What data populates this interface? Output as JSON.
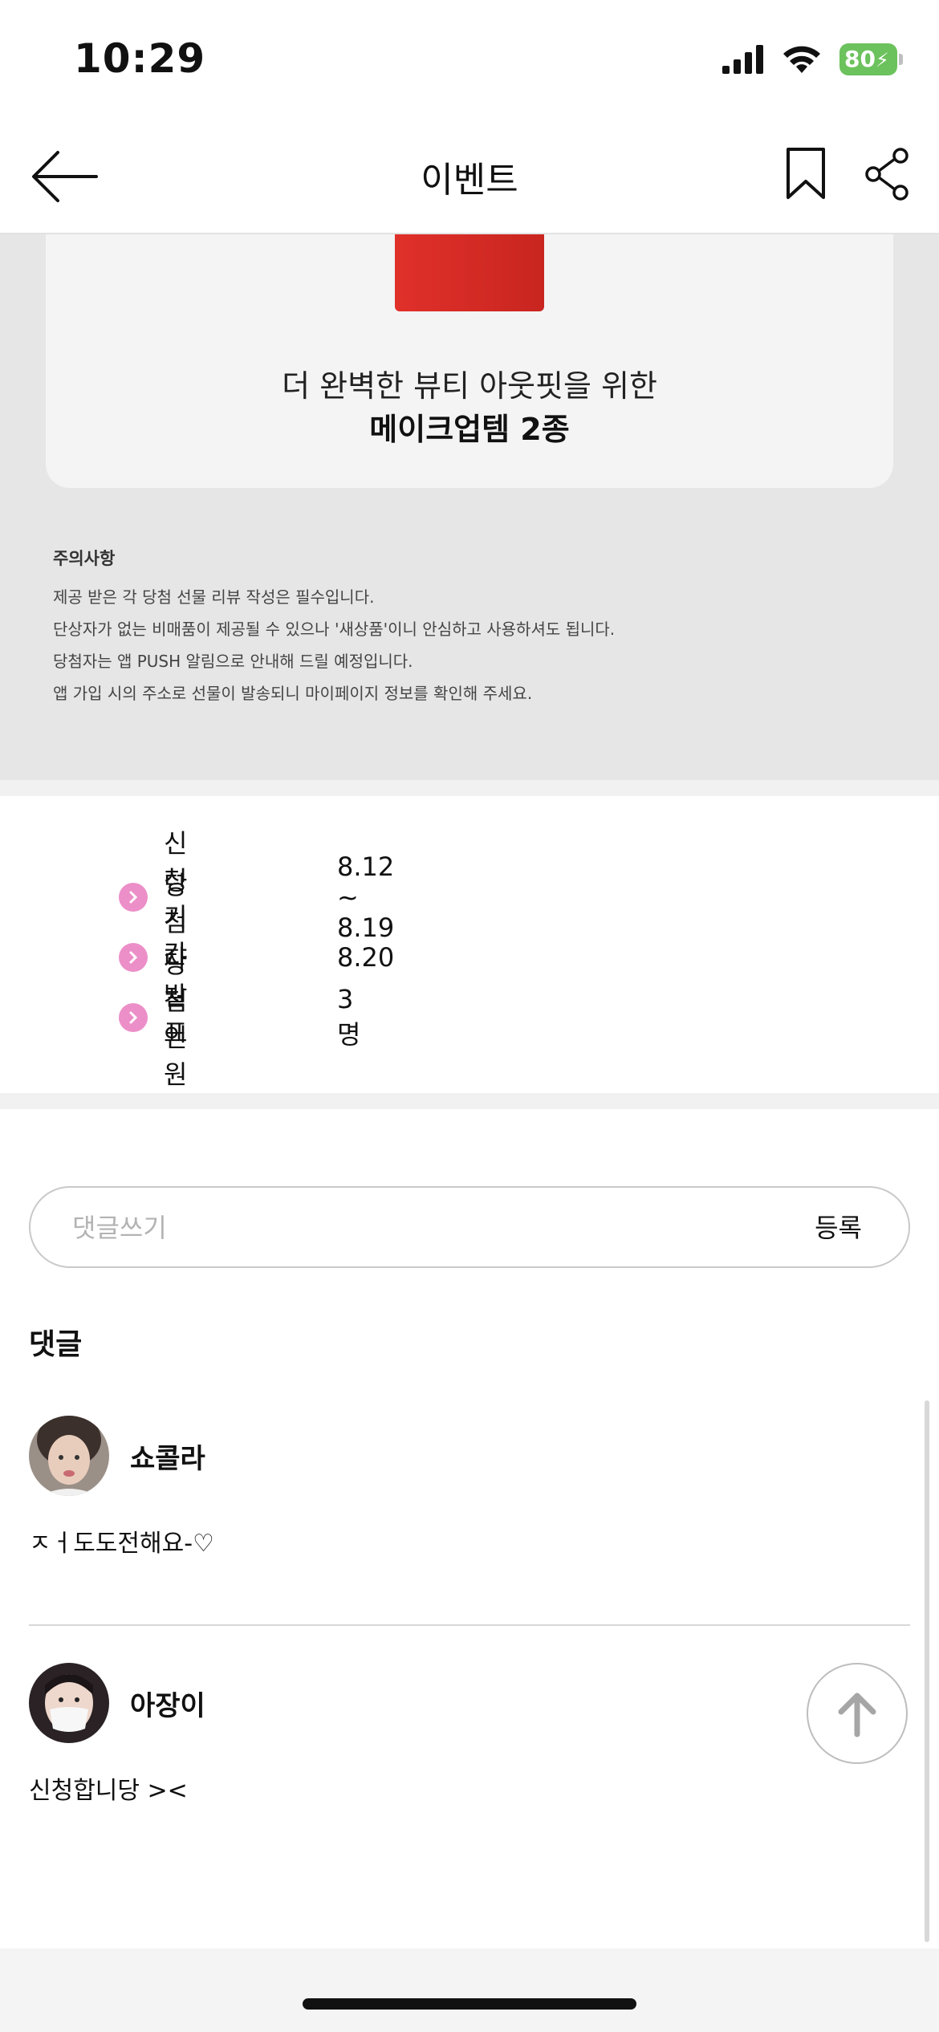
{
  "status_bar": {
    "time": "10:29",
    "battery": "80"
  },
  "nav": {
    "title": "이벤트",
    "icons": [
      "back-arrow-icon",
      "bookmark-icon",
      "share-icon"
    ]
  },
  "event_card": {
    "line1": "더 완벽한 뷰티 아웃핏을 위한",
    "line2": "메이크업템 2종"
  },
  "notice": {
    "title": "주의사항",
    "lines": [
      "제공 받은 각 당첨 선물 리뷰 작성은 필수입니다.",
      "단상자가 없는 비매품이 제공될 수 있으나 '새상품'이니 안심하고 사용하셔도 됩니다.",
      "당첨자는 앱 PUSH 알림으로 안내해 드릴 예정입니다.",
      "앱 가입 시의 주소로 선물이 발송되니 마이페이지 정보를 확인해 주세요."
    ]
  },
  "event_info": [
    {
      "label": "신청기간",
      "value": "8.12 ~ 8.19"
    },
    {
      "label": "당첨자 발표",
      "value": "8.20"
    },
    {
      "label": "당첨 인원",
      "value": "3명"
    }
  ],
  "comment_form": {
    "placeholder": "댓글쓰기",
    "submit_label": "등록"
  },
  "comments_title": "댓글",
  "comments": [
    {
      "name": "쇼콜라",
      "text": "ㅈㅓ도도전해요-♡"
    },
    {
      "name": "아장이",
      "text": "신청합니당 ><"
    }
  ],
  "colors": {
    "accent_pink": "#ec8fc8",
    "event_red": "#d9291f",
    "battery_green": "#6cc25c"
  }
}
